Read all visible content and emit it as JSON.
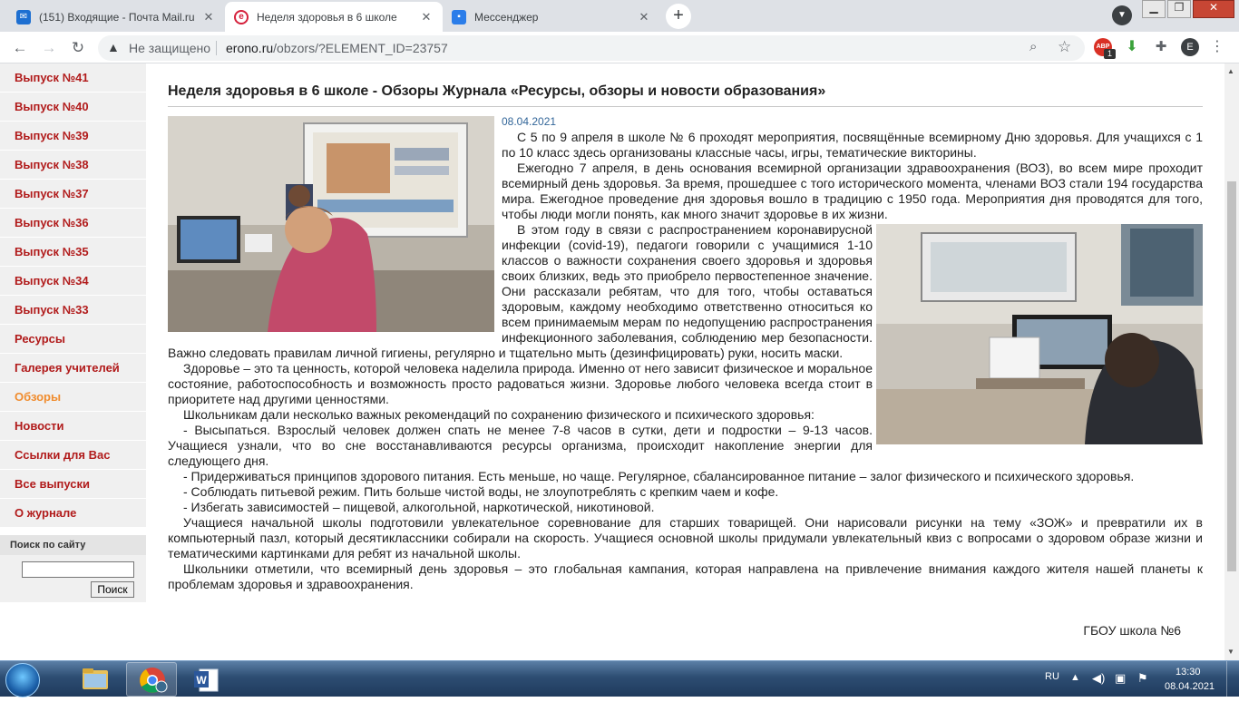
{
  "browser": {
    "tabs": [
      {
        "title": "(151) Входящие - Почта Mail.ru"
      },
      {
        "title": "Неделя здоровья в 6 школе"
      },
      {
        "title": "Мессенджер"
      }
    ],
    "security_label": "Не защищено",
    "url_host": "erono.ru",
    "url_path": "/obzors/?ELEMENT_ID=23757",
    "new_tab": "+",
    "profile_initial": "E",
    "adblock_count": "1"
  },
  "sidebar": {
    "items": [
      {
        "label": "Выпуск №41"
      },
      {
        "label": "Выпуск №40"
      },
      {
        "label": "Выпуск №39"
      },
      {
        "label": "Выпуск №38"
      },
      {
        "label": "Выпуск №37"
      },
      {
        "label": "Выпуск №36"
      },
      {
        "label": "Выпуск №35"
      },
      {
        "label": "Выпуск №34"
      },
      {
        "label": "Выпуск №33"
      },
      {
        "label": "Ресурсы"
      },
      {
        "label": "Галерея учителей"
      },
      {
        "label": "Обзоры"
      },
      {
        "label": "Новости"
      },
      {
        "label": "Ссылки для Вас"
      },
      {
        "label": "Все выпуски"
      },
      {
        "label": "О журнале"
      }
    ],
    "search_title": "Поиск по сайту",
    "search_value": "",
    "search_button": "Поиск"
  },
  "article": {
    "title": "Неделя здоровья в 6 школе - Обзоры Журнала «Ресурсы, обзоры и новости образования»",
    "date": "08.04.2021",
    "paragraphs": [
      "С 5 по 9 апреля в школе № 6 проходят мероприятия, посвящённые всемирному Дню здоровья. Для учащихся с 1 по 10 класс здесь организованы классные часы, игры, тематические викторины.",
      "Ежегодно 7 апреля, в день основания всемирной организации здравоохранения (ВОЗ), во всем мире проходит всемирный день здоровья. За время, прошедшее с того исторического момента, членами ВОЗ стали 194 государства мира. Ежегодное проведение дня здоровья вошло в традицию с 1950 года. Мероприятия дня проводятся для того, чтобы люди могли понять, как много значит здоровье в их жизни.",
      "В этом году в связи с распространением коронавирусной инфекции (covid-19), педагоги говорили с учащимися 1-10 классов о важности сохранения своего здоровья и здоровья своих близких, ведь это приобрело первостепенное значение. Они рассказали ребятам, что для того, чтобы оставаться здоровым, каждому необходимо ответственно относиться ко всем принимаемым мерам по недопущению распространения инфекционного заболевания, соблюдению мер безопасности. Важно следовать правилам личной гигиены, регулярно и тщательно мыть (дезинфицировать) руки, носить маски.",
      "Здоровье – это та ценность, которой человека наделила природа. Именно от него зависит физическое и моральное состояние, работоспособность и возможность просто радоваться жизни. Здоровье любого человека всегда стоит в приоритете над другими ценностями.",
      "Школьникам дали несколько важных рекомендаций по сохранению физического и психического здоровья:",
      "- Высыпаться. Взрослый человек должен спать не менее 7-8 часов в сутки, дети и подростки – 9-13 часов. Учащиеся узнали, что во сне восстанавливаются ресурсы организма, происходит накопление энергии для следующего дня.",
      "- Придерживаться принципов здорового питания. Есть меньше, но чаще. Регулярное, сбалансированное питание – залог физического и психического здоровья.",
      "- Соблюдать питьевой режим. Пить больше чистой воды, не злоупотреблять с крепким чаем и кофе.",
      "- Избегать зависимостей – пищевой, алкогольной, наркотической, никотиновой.",
      "Учащиеся начальной школы подготовили увлекательное соревнование для старших товарищей. Они нарисовали рисунки на тему «ЗОЖ» и превратили их в компьютерный пазл, который десятиклассники собирали на скорость. Учащиеся основной школы придумали увлекательный квиз с вопросами о здоровом образе жизни и тематическими картинками для ребят из начальной школы.",
      "Школьники отметили, что всемирный день здоровья – это глобальная кампания, которая направлена на привлечение внимания каждого жителя нашей планеты к проблемам здоровья и здравоохранения."
    ],
    "signature": "ГБОУ школа №6"
  },
  "taskbar": {
    "language": "RU",
    "time": "13:30",
    "date": "08.04.2021"
  },
  "colors": {
    "menu_link": "#b11b1b",
    "menu_current": "#f08c2e",
    "date": "#336699"
  }
}
